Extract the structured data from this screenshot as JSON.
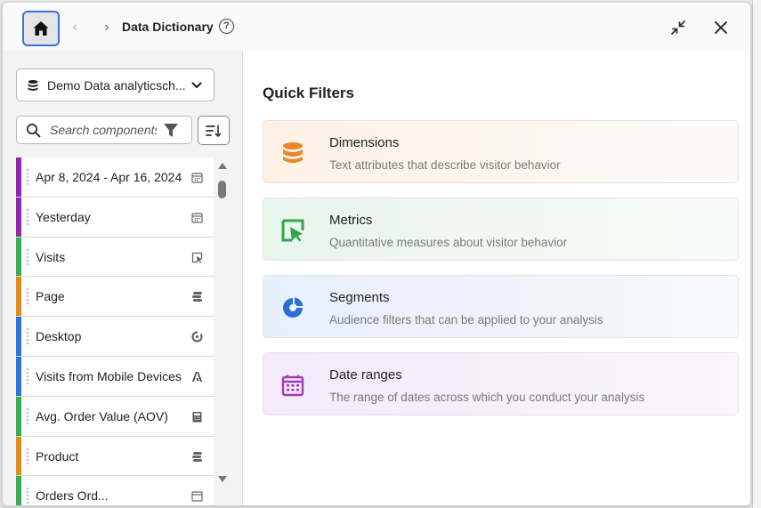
{
  "header": {
    "title": "Data Dictionary",
    "help": "?"
  },
  "sidebar": {
    "data_source": "Demo Data analyticsch...",
    "search_placeholder": "Search components",
    "items": [
      {
        "label": "Apr 8, 2024 - Apr 16, 2024",
        "color": "#8e2aa8",
        "icon": "calendar-icon"
      },
      {
        "label": "Yesterday",
        "color": "#8e2aa8",
        "icon": "calendar-icon"
      },
      {
        "label": "Visits",
        "color": "#3faa4f",
        "icon": "metric-icon"
      },
      {
        "label": "Page",
        "color": "#e18b25",
        "icon": "dimension-icon"
      },
      {
        "label": "Desktop",
        "color": "#2e75d8",
        "icon": "segment-icon"
      },
      {
        "label": "Visits from Mobile Devices",
        "color": "#2e75d8",
        "icon": "adobe-icon"
      },
      {
        "label": "Avg. Order Value (AOV)",
        "color": "#3faa4f",
        "icon": "calculator-icon"
      },
      {
        "label": "Product",
        "color": "#e18b25",
        "icon": "dimension-icon"
      },
      {
        "label": "Orders Ord...",
        "color": "#3faa4f",
        "icon": "calendar-icon"
      }
    ]
  },
  "main": {
    "title": "Quick Filters",
    "cards": [
      {
        "title": "Dimensions",
        "description": "Text attributes that describe visitor behavior",
        "icon": "database-icon",
        "accent": "#e8862a"
      },
      {
        "title": "Metrics",
        "description": "Quantitative measures about visitor behavior",
        "icon": "metrics-icon",
        "accent": "#2ea84a"
      },
      {
        "title": "Segments",
        "description": "Audience filters that can be applied to your analysis",
        "icon": "segments-icon",
        "accent": "#2b6fd4"
      },
      {
        "title": "Date ranges",
        "description": "The range of dates across which you conduct your analysis",
        "icon": "calendar-icon",
        "accent": "#a238b8"
      }
    ]
  }
}
